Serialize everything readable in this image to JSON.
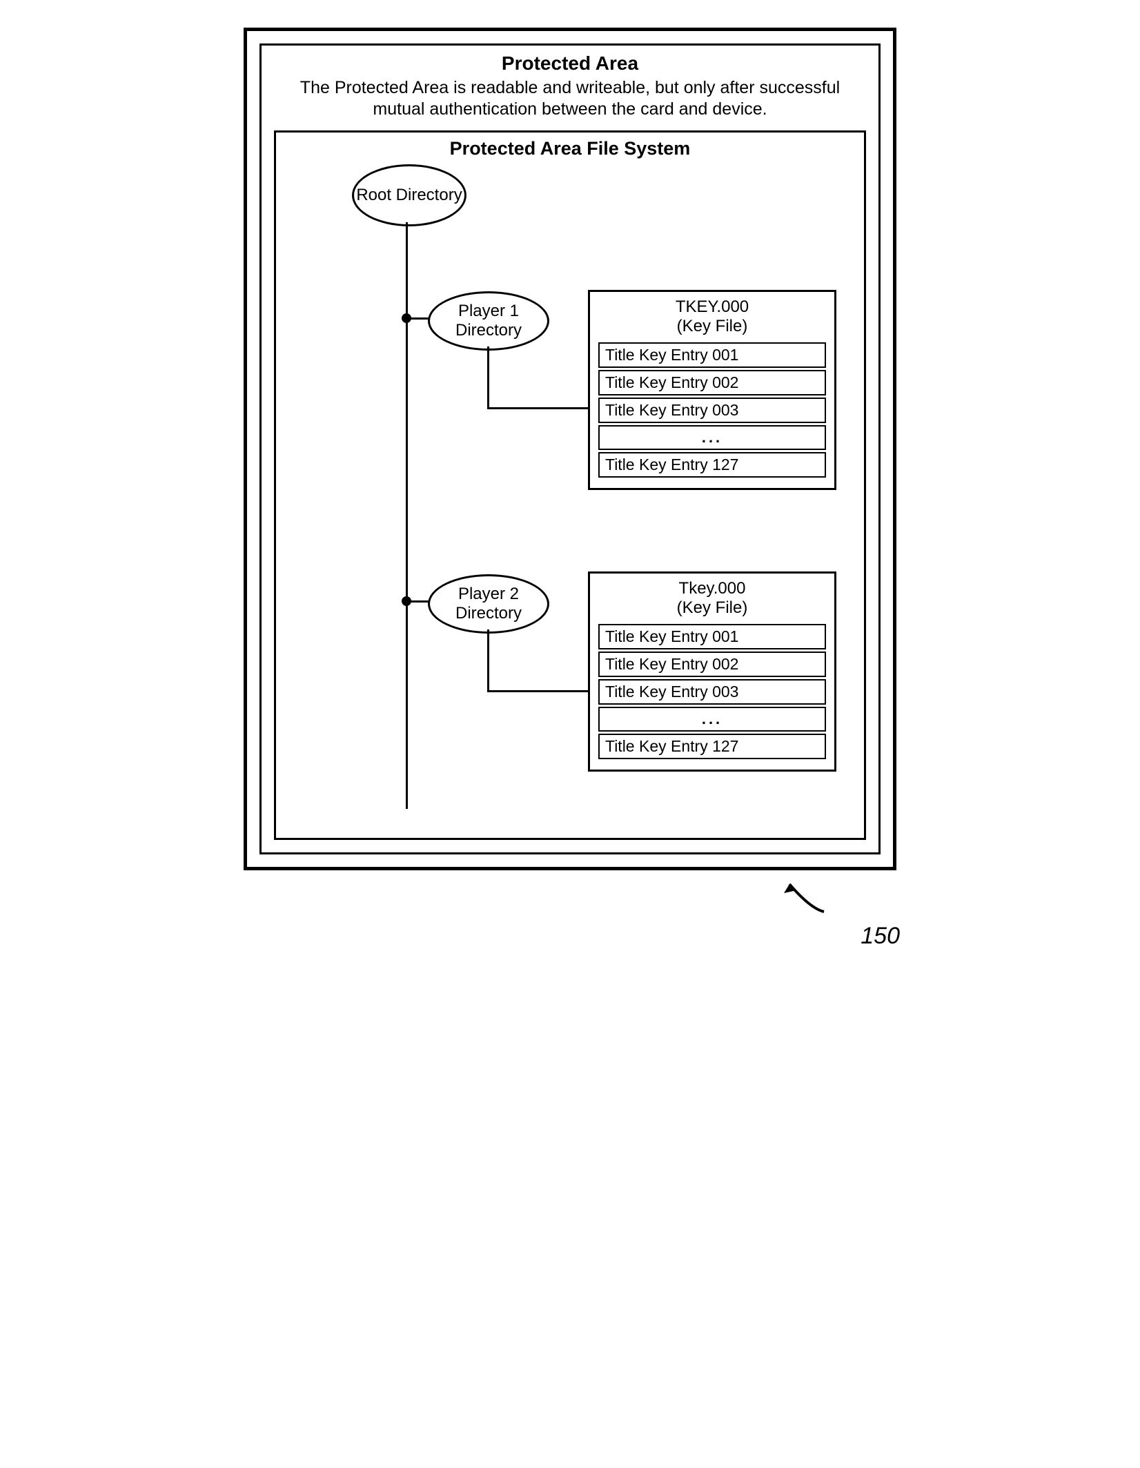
{
  "protectedArea": {
    "title": "Protected Area",
    "description": "The Protected Area is readable and writeable, but only after successful mutual authentication between the card and device."
  },
  "fileSystem": {
    "title": "Protected Area File System",
    "root": "Root Directory",
    "player1": {
      "label": "Player 1 Directory",
      "keyfile": {
        "name": "TKEY.000",
        "sub": "(Key File)",
        "entries": [
          "Title Key Entry 001",
          "Title Key Entry 002",
          "Title Key Entry 003",
          "...",
          "Title Key Entry 127"
        ]
      }
    },
    "player2": {
      "label": "Player 2 Directory",
      "keyfile": {
        "name": "Tkey.000",
        "sub": "(Key File)",
        "entries": [
          "Title Key Entry 001",
          "Title Key Entry 002",
          "Title Key Entry 003",
          "...",
          "Title Key Entry 127"
        ]
      }
    }
  },
  "figureRef": "150"
}
